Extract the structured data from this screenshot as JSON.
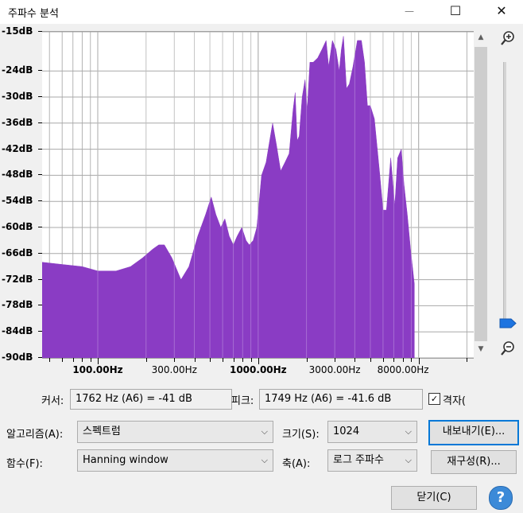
{
  "window": {
    "title": "주파수 분석",
    "minimize_glyph": "—",
    "maximize_glyph": "☐",
    "close_glyph": "✕"
  },
  "plot": {
    "y_labels": [
      "-15dB",
      "-24dB",
      "-30dB",
      "-36dB",
      "-42dB",
      "-48dB",
      "-54dB",
      "-60dB",
      "-66dB",
      "-72dB",
      "-78dB",
      "-84dB",
      "-90dB"
    ],
    "x_labels": [
      "100.00Hz",
      "300.00Hz",
      "1000.00Hz",
      "3000.00Hz",
      "8000.00Hz"
    ],
    "spectrum_color": "#8a3cc4"
  },
  "chart_data": {
    "type": "area",
    "x_scale": "log",
    "xlim_hz": [
      45,
      22050
    ],
    "ylim_db": [
      -90,
      -15
    ],
    "grid": true,
    "x_tick_labels": [
      "100.00Hz",
      "300.00Hz",
      "1000.00Hz",
      "3000.00Hz",
      "8000.00Hz"
    ],
    "y_tick_labels": [
      "-15dB",
      "-24dB",
      "-30dB",
      "-36dB",
      "-42dB",
      "-48dB",
      "-54dB",
      "-60dB",
      "-66dB",
      "-72dB",
      "-78dB",
      "-84dB",
      "-90dB"
    ],
    "series": [
      {
        "x": [
          45,
          60,
          80,
          100,
          130,
          160,
          190,
          220,
          240,
          260,
          290,
          330,
          370,
          420,
          470,
          510,
          545,
          585,
          620,
          660,
          700,
          740,
          790,
          840,
          880,
          930,
          980,
          1050,
          1120,
          1180,
          1230,
          1300,
          1380,
          1470,
          1560,
          1650,
          1700,
          1749,
          1800,
          1880,
          1960,
          2020,
          2100,
          2200,
          2350,
          2500,
          2650,
          2750,
          2900,
          3050,
          3200,
          3300,
          3400,
          3450,
          3550,
          3700,
          3900,
          4150,
          4400,
          4600,
          4800,
          5000,
          5300,
          5700,
          6000,
          6300,
          6700,
          7100,
          7400,
          7800,
          8100,
          8500,
          8900,
          9400
        ],
        "y": [
          -68,
          -68.5,
          -69,
          -70,
          -70,
          -69,
          -67,
          -65,
          -64,
          -64,
          -67,
          -72,
          -69,
          -62,
          -57,
          -53,
          -57,
          -60,
          -58,
          -62,
          -64,
          -62,
          -60,
          -63,
          -64,
          -63,
          -60,
          -48,
          -45,
          -40,
          -36,
          -41,
          -47,
          -45,
          -43,
          -33,
          -29,
          -40,
          -39,
          -30,
          -26,
          -33,
          -22,
          -22,
          -21,
          -19,
          -17,
          -23,
          -17,
          -19,
          -24,
          -19,
          -16,
          -20,
          -28,
          -27,
          -23,
          -17,
          -17,
          -22,
          -32,
          -32,
          -35,
          -47,
          -56,
          -56,
          -44,
          -55,
          -44,
          -42,
          -50,
          -57,
          -65,
          -73
        ]
      }
    ]
  },
  "controls": {
    "cursor_label": "커서:",
    "cursor_value": "1762 Hz (A6) = -41 dB",
    "peak_label": "피크:",
    "peak_value": "1749 Hz (A6) = -41.6 dB",
    "grid_checkbox_label": "격자(",
    "grid_checked_glyph": "✓",
    "algorithm_label": "알고리즘(A):",
    "algorithm_value": "스펙트럼",
    "size_label": "크기(S):",
    "size_value": "1024",
    "export_button": "내보내기(E)...",
    "function_label": "함수(F):",
    "function_value": "Hanning window",
    "axis_label": "축(A):",
    "axis_value": "로그 주파수",
    "replot_button": "재구성(R)...",
    "close_button": "닫기(C)",
    "help_glyph": "?",
    "chevron_glyph": "⌵"
  }
}
